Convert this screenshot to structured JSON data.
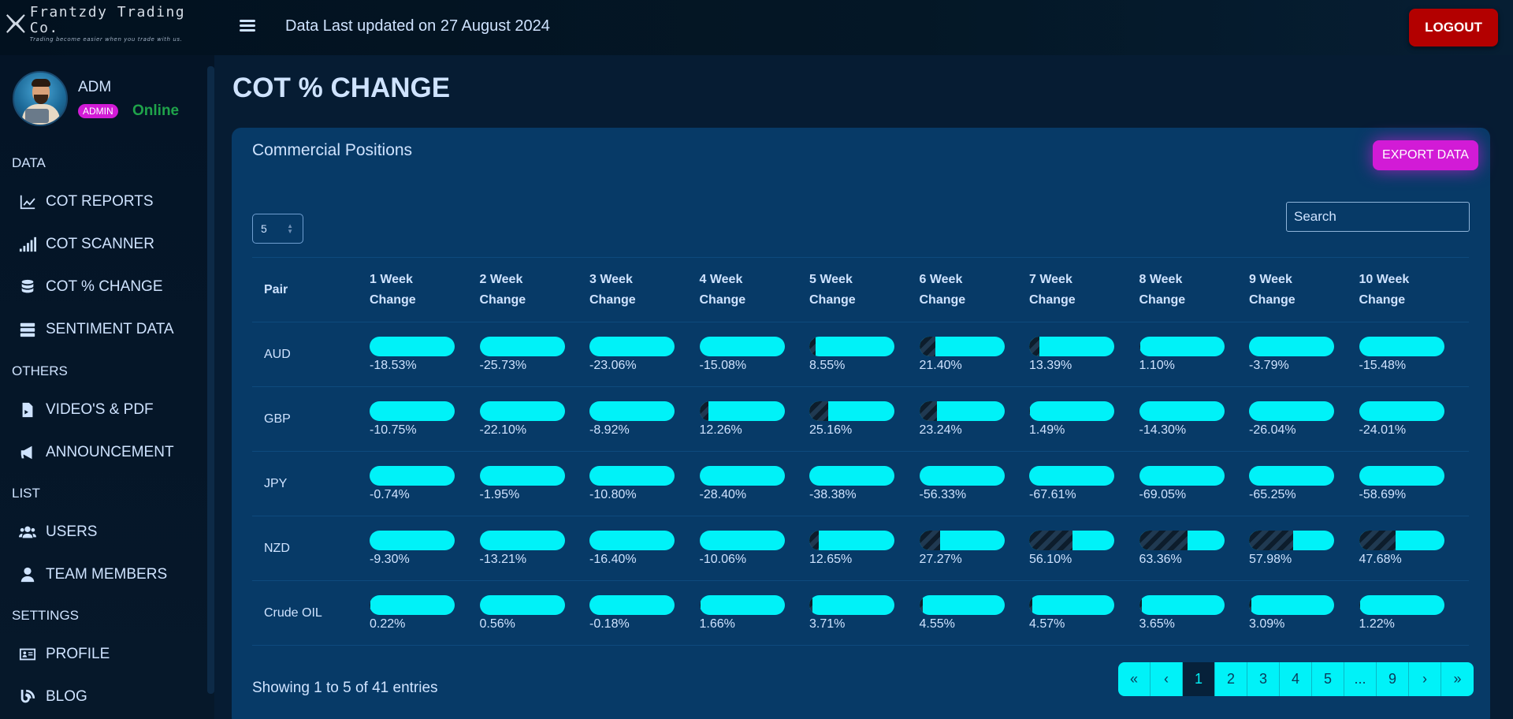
{
  "brand": {
    "name": "Frantzdy Trading Co.",
    "tagline": "Trading become easier when you trade with us."
  },
  "header": {
    "updated": "Data Last updated on 27 August 2024",
    "logout": "LOGOUT"
  },
  "user": {
    "name": "ADM",
    "role": "ADMIN",
    "status": "Online"
  },
  "sidebar": {
    "sections": [
      {
        "label": "DATA",
        "items": [
          {
            "label": "COT REPORTS",
            "icon": "chart-line-icon"
          },
          {
            "label": "COT SCANNER",
            "icon": "signal-bars-icon"
          },
          {
            "label": "COT % CHANGE",
            "icon": "database-icon"
          },
          {
            "label": "SENTIMENT DATA",
            "icon": "server-icon"
          }
        ]
      },
      {
        "label": "OTHERS",
        "items": [
          {
            "label": "VIDEO'S & PDF",
            "icon": "file-video-icon"
          },
          {
            "label": "ANNOUNCEMENT",
            "icon": "bullhorn-icon"
          }
        ]
      },
      {
        "label": "LIST",
        "items": [
          {
            "label": "USERS",
            "icon": "users-icon"
          },
          {
            "label": "TEAM MEMBERS",
            "icon": "user-tie-icon"
          }
        ]
      },
      {
        "label": "SETTINGS",
        "items": [
          {
            "label": "PROFILE",
            "icon": "id-card-icon"
          },
          {
            "label": "BLOG",
            "icon": "blog-icon"
          }
        ]
      }
    ]
  },
  "page": {
    "title": "COT % CHANGE"
  },
  "card": {
    "title": "Commercial Positions",
    "export": "EXPORT DATA",
    "page_size": "5",
    "search_placeholder": "Search",
    "columns": [
      "Pair",
      "1 Week\nChange",
      "2 Week\nChange",
      "3 Week\nChange",
      "4 Week\nChange",
      "5 Week\nChange",
      "6 Week\nChange",
      "7 Week\nChange",
      "8 Week\nChange",
      "9 Week\nChange",
      "10 Week\nChange"
    ],
    "rows": [
      {
        "pair": "AUD",
        "values": [
          "-18.53%",
          "-25.73%",
          "-23.06%",
          "-15.08%",
          "8.55%",
          "21.40%",
          "13.39%",
          "1.10%",
          "-3.79%",
          "-15.48%"
        ]
      },
      {
        "pair": "GBP",
        "values": [
          "-10.75%",
          "-22.10%",
          "-8.92%",
          "12.26%",
          "25.16%",
          "23.24%",
          "1.49%",
          "-14.30%",
          "-26.04%",
          "-24.01%"
        ]
      },
      {
        "pair": "JPY",
        "values": [
          "-0.74%",
          "-1.95%",
          "-10.80%",
          "-28.40%",
          "-38.38%",
          "-56.33%",
          "-67.61%",
          "-69.05%",
          "-65.25%",
          "-58.69%"
        ]
      },
      {
        "pair": "NZD",
        "values": [
          "-9.30%",
          "-13.21%",
          "-16.40%",
          "-10.06%",
          "12.65%",
          "27.27%",
          "56.10%",
          "63.36%",
          "57.98%",
          "47.68%"
        ]
      },
      {
        "pair": "Crude OIL",
        "values": [
          "0.22%",
          "0.56%",
          "-0.18%",
          "1.66%",
          "3.71%",
          "4.55%",
          "4.57%",
          "3.65%",
          "3.09%",
          "1.22%"
        ]
      }
    ],
    "footer": "Showing 1 to 5 of 41 entries",
    "pagination": [
      "«",
      "‹",
      "1",
      "2",
      "3",
      "4",
      "5",
      "...",
      "9",
      "›",
      "»"
    ],
    "active_page": "1"
  },
  "colors": {
    "accent": "#00f2f8",
    "magenta": "#d21bd6",
    "logout": "#b30000"
  }
}
